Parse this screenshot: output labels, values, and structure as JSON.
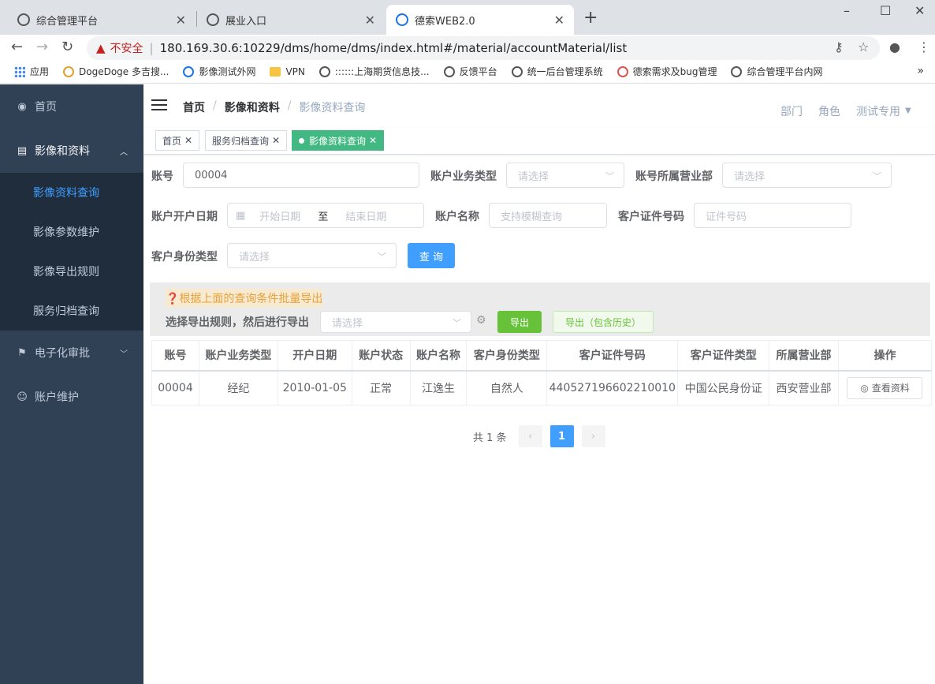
{
  "browser": {
    "tabs": [
      {
        "title": "综合管理平台"
      },
      {
        "title": "展业入口"
      },
      {
        "title": "德索WEB2.0"
      }
    ],
    "new_tab": "+",
    "security_label": "不安全",
    "url": "180.169.30.6:10229/dms/home/dms/index.html#/material/accountMaterial/list",
    "bookmarks": [
      "应用",
      "DogeDoge 多吉搜...",
      "影像测试外网",
      "VPN",
      "::::::上海期货信息技...",
      "反馈平台",
      "统一后台管理系统",
      "德索需求及bug管理",
      "综合管理平台内网"
    ],
    "bookmarks_more": "»"
  },
  "sidebar": {
    "items": [
      {
        "label": "首页",
        "icon": "dashboard-icon"
      },
      {
        "label": "影像和资料",
        "icon": "document-icon"
      },
      {
        "label": "电子化审批",
        "icon": "flag-icon"
      },
      {
        "label": "账户维护",
        "icon": "user-icon"
      }
    ],
    "sub_items": [
      "影像资料查询",
      "影像参数维护",
      "影像导出规则",
      "服务归档查询"
    ]
  },
  "navbar": {
    "breadcrumb": [
      "首页",
      "影像和资料",
      "影像资料查询"
    ],
    "right": [
      "部门",
      "角色",
      "测试专用"
    ]
  },
  "tags": [
    "首页",
    "服务归档查询",
    "影像资料查询"
  ],
  "form": {
    "account_label": "账号",
    "account_value": "00004",
    "biz_type_label": "账户业务类型",
    "biz_type_placeholder": "请选择",
    "dept_label": "账号所属营业部",
    "dept_placeholder": "请选择",
    "open_date_label": "账户开户日期",
    "start_placeholder": "开始日期",
    "date_sep": "至",
    "end_placeholder": "结束日期",
    "name_label": "账户名称",
    "name_placeholder": "支持模糊查询",
    "cert_no_label": "客户证件号码",
    "cert_no_placeholder": "证件号码",
    "identity_label": "客户身份类型",
    "identity_placeholder": "请选择",
    "query_button": "查 询"
  },
  "export": {
    "hint": "根据上面的查询条件批量导出",
    "rule_label": "选择导出规则，然后进行导出",
    "rule_placeholder": "请选择",
    "export_button": "导出",
    "export_history_button": "导出（包含历史）"
  },
  "table": {
    "headers": [
      "账号",
      "账户业务类型",
      "开户日期",
      "账户状态",
      "账户名称",
      "客户身份类型",
      "客户证件号码",
      "客户证件类型",
      "所属营业部",
      "操作"
    ],
    "rows": [
      {
        "cells": [
          "00004",
          "经纪",
          "2010-01-05",
          "正常",
          "江逸生",
          "自然人",
          "440527196602210010",
          "中国公民身份证",
          "西安营业部"
        ],
        "action": "查看资料"
      }
    ]
  },
  "pagination": {
    "total": "共 1 条",
    "current_page": "1"
  }
}
